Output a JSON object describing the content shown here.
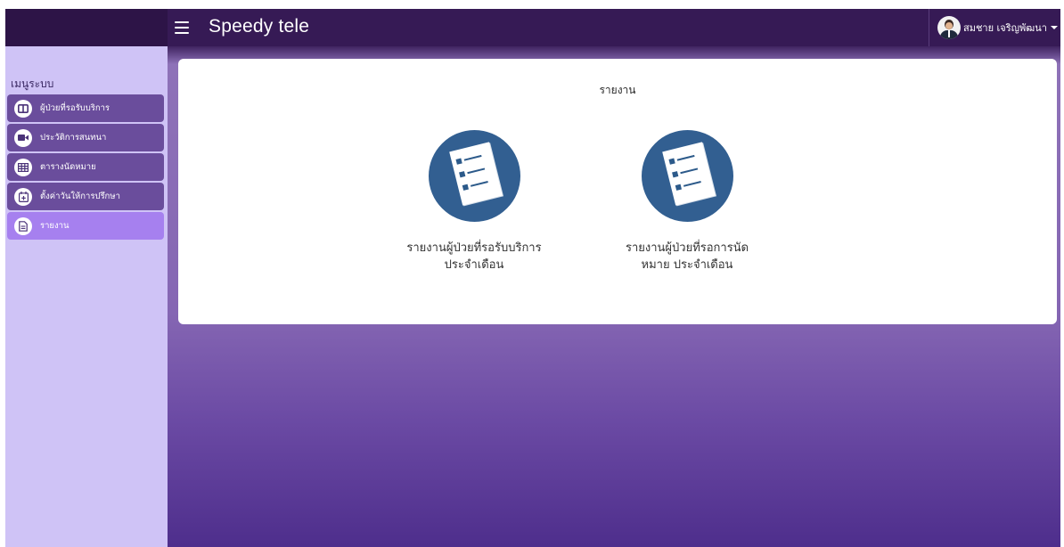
{
  "app": {
    "title": "Speedy tele"
  },
  "user": {
    "name": "สมชาย เจริญพัฒนา"
  },
  "sidebar": {
    "heading": "เมนูระบบ",
    "items": [
      {
        "label": "ผู้ป่วยที่รอรับบริการ",
        "icon": "columns-icon"
      },
      {
        "label": "ประวัติการสนทนา",
        "icon": "video-camera-icon"
      },
      {
        "label": "ตารางนัดหมาย",
        "icon": "table-icon"
      },
      {
        "label": "ตั้งค่าวันให้การปรึกษา",
        "icon": "calendar-plus-icon"
      },
      {
        "label": "รายงาน",
        "icon": "document-icon"
      }
    ]
  },
  "main": {
    "title": "รายงาน",
    "reports": [
      {
        "label_line1": "รายงานผู้ป่วยที่รอรับบริการ",
        "label_line2": "ประจำเดือน",
        "icon": "checklist-icon"
      },
      {
        "label_line1": "รายงานผู้ป่วยที่รอการนัด",
        "label_line2": "หมาย ประจำเดือน",
        "icon": "checklist-icon"
      }
    ]
  },
  "colors": {
    "topbar": "#361a55",
    "sidebar": "#cfc3f6",
    "menu_item": "#6a4d9c",
    "menu_item_active": "#a680ef",
    "report_circle": "#325f91"
  }
}
